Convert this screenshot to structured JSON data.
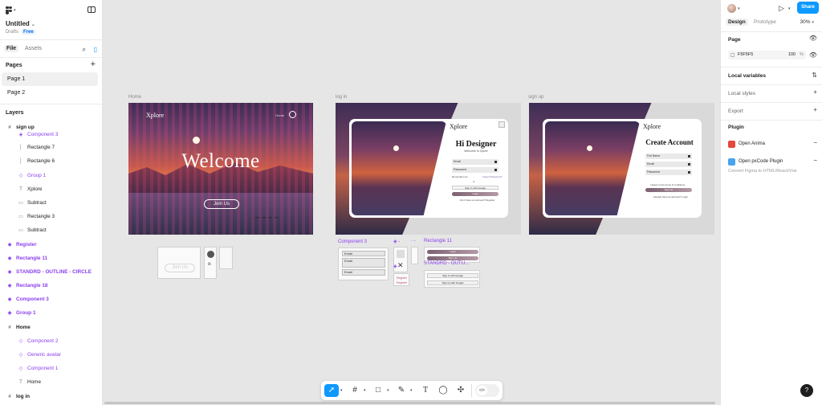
{
  "file": {
    "title": "Untitled",
    "location": "Drafts",
    "plan": "Free"
  },
  "left_tabs": {
    "file": "File",
    "assets": "Assets"
  },
  "pages": {
    "header": "Pages",
    "items": [
      "Page 1",
      "Page 2"
    ]
  },
  "layers": {
    "header": "Layers",
    "items": [
      {
        "name": "sign up",
        "kind": "frame"
      },
      {
        "name": "Component 3",
        "kind": "component"
      },
      {
        "name": "Rectangle 7",
        "kind": "rect"
      },
      {
        "name": "Rectangle 6",
        "kind": "rect"
      },
      {
        "name": "Group 1",
        "kind": "component"
      },
      {
        "name": "Xplore",
        "kind": "text"
      },
      {
        "name": "Subtract",
        "kind": "shape"
      },
      {
        "name": "Rectangle 3",
        "kind": "shape"
      },
      {
        "name": "Subtract",
        "kind": "shape"
      },
      {
        "name": "Register",
        "kind": "component-top"
      },
      {
        "name": "Rectangle 11",
        "kind": "component-top"
      },
      {
        "name": "STANDRD - OUTLINE - CIRCLE",
        "kind": "component-top"
      },
      {
        "name": "Rectangle 18",
        "kind": "component-top"
      },
      {
        "name": "Component 3",
        "kind": "component-top"
      },
      {
        "name": "Group 1",
        "kind": "component-top"
      },
      {
        "name": "Home",
        "kind": "frame"
      },
      {
        "name": "Component 2",
        "kind": "component"
      },
      {
        "name": "Generic avatar",
        "kind": "component"
      },
      {
        "name": "Component 1",
        "kind": "component"
      },
      {
        "name": "Home",
        "kind": "text"
      },
      {
        "name": "log in",
        "kind": "frame"
      }
    ]
  },
  "canvas": {
    "frames": {
      "home": {
        "label": "Home",
        "brand": "Xplore",
        "nav_link": "Home",
        "headline": "Welcome",
        "cta": "Join Us"
      },
      "login": {
        "label": "log in",
        "brand": "Xplore",
        "title": "Hi Designer",
        "subtitle": "Welcome to Xplore",
        "email": "Email",
        "password": "Password",
        "remember": "Remember me",
        "forgot": "Forgot Password?",
        "or": "or",
        "google": "Sign in with Google",
        "login_btn": "Login",
        "footer": "Don't have an account? Register"
      },
      "signup": {
        "label": "sign up",
        "brand": "Xplore",
        "title": "Create Account",
        "full_name": "Full Name",
        "email": "Email",
        "password": "Password",
        "terms": "I agree to the terms & conditions",
        "signup_btn": "Sign Up",
        "footer": "Already have an account? Login"
      }
    },
    "components": {
      "join_us": "Join Us",
      "component3": "Component 3",
      "email": "Email",
      "email2": "Email",
      "email3": "Email",
      "rect11": "Rectangle 11",
      "standrd": "STANDRD - OUTLI...",
      "login_small": "Login",
      "signup_small": "Sign Up",
      "google_small": "Sign in with Google",
      "google_small2": "Sign up with Google",
      "register_a": "Register",
      "register_b": "Register"
    }
  },
  "right": {
    "share": "Share",
    "tabs": {
      "design": "Design",
      "prototype": "Prototype"
    },
    "zoom": "30%",
    "page_section": "Page",
    "page_color": "F5F5F5",
    "page_opacity": "100",
    "pct": "%",
    "local_variables": "Local variables",
    "local_styles": "Local styles",
    "export": "Export",
    "plugin_section": "Plugin",
    "plugins": [
      {
        "name": "Open Anima",
        "color": "#e5483d"
      },
      {
        "name": "Open pxCode Plugin",
        "color": "#4aa3f0"
      }
    ],
    "plugin_desc": "Convert Figma to HTML/React/Vue",
    "help": "?"
  },
  "colors": {
    "accent": "#0d99ff",
    "component": "#8b3ef0"
  }
}
